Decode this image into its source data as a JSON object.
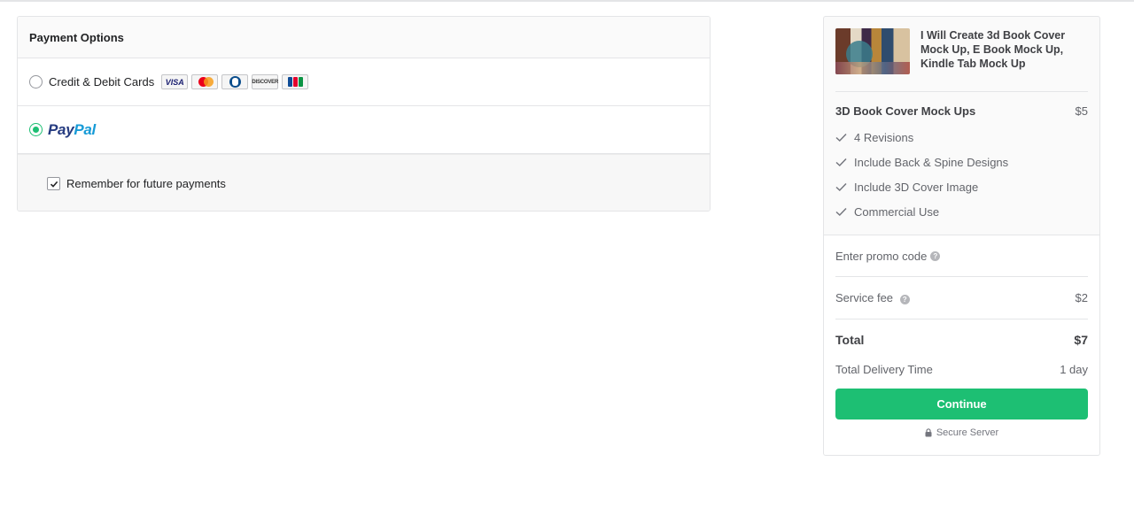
{
  "payment": {
    "title": "Payment Options",
    "card_option_label": "Credit & Debit Cards",
    "cards": [
      "VISA",
      "mastercard",
      "diners",
      "DISCOVER",
      "JCB"
    ],
    "paypal_pay": "Pay",
    "paypal_pal": "Pal",
    "selected_option": "paypal",
    "remember_label": "Remember for future payments",
    "remember_checked": true
  },
  "summary": {
    "gig_title": "I Will Create 3d Book Cover Mock Up, E Book Mock Up, Kindle Tab Mock Up",
    "package_name": "3D Book Cover Mock Ups",
    "package_price": "$5",
    "features": [
      "4 Revisions",
      "Include Back & Spine Designs",
      "Include 3D Cover Image",
      "Commercial Use"
    ],
    "promo_label": "Enter promo code",
    "service_fee_label": "Service fee",
    "service_fee_value": "$2",
    "total_label": "Total",
    "total_value": "$7",
    "delivery_label": "Total Delivery Time",
    "delivery_value": "1 day",
    "continue_label": "Continue",
    "secure_label": "Secure Server"
  },
  "colors": {
    "accent": "#1dbf73",
    "paypal_dark": "#253b80",
    "paypal_light": "#179bd7"
  }
}
